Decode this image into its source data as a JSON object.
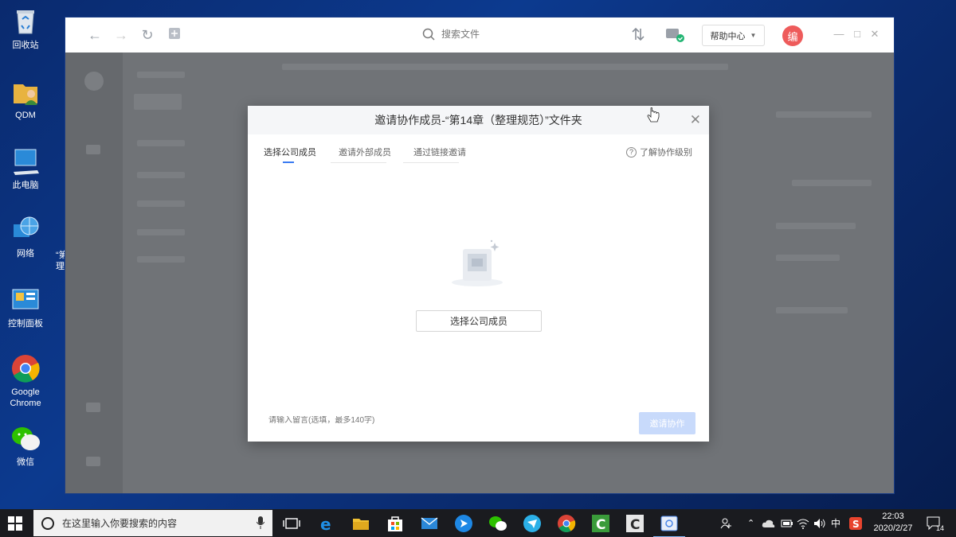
{
  "desktop": {
    "icons": [
      {
        "label": "回收站"
      },
      {
        "label": "QDM"
      },
      {
        "label": "此电脑"
      },
      {
        "label": "网络"
      },
      {
        "label": "控制面板"
      },
      {
        "label": "Google Chrome"
      },
      {
        "label": "微信"
      }
    ],
    "partial_labels": [
      "“第",
      "理"
    ]
  },
  "toolbar": {
    "search_placeholder": "搜索文件",
    "help_center": "帮助中心",
    "avatar_text": "编"
  },
  "modal": {
    "title": "邀请协作成员-“第14章（整理规范）”文件夹",
    "tabs": [
      "选择公司成员",
      "邀请外部成员",
      "通过链接邀请"
    ],
    "active_tab": 0,
    "help_link": "了解协作级别",
    "select_button": "选择公司成员",
    "message_placeholder": "请输入留言(选填，最多140字)",
    "invite_button": "邀请协作"
  },
  "taskbar": {
    "search_placeholder": "在这里输入你要搜索的内容",
    "ime": "中",
    "time": "22:03",
    "date": "2020/2/27",
    "notification_count": "14"
  },
  "colors": {
    "accent": "#3a7bf2",
    "invite_disabled": "#c8dafb",
    "avatar": "#ee5b5b"
  }
}
